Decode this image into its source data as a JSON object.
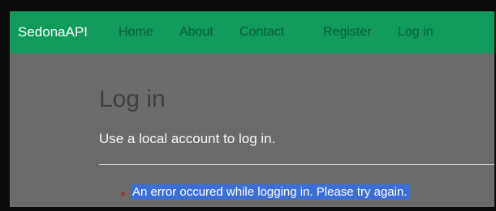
{
  "navbar": {
    "brand": "SedonaAPI",
    "links": [
      {
        "label": "Home"
      },
      {
        "label": "About"
      },
      {
        "label": "Contact"
      },
      {
        "label": "Register"
      },
      {
        "label": "Log in"
      }
    ]
  },
  "page": {
    "title": "Log in",
    "subtitle": "Use a local account to log in.",
    "error_message": "An error occured while logging in. Please try again."
  },
  "colors": {
    "navbar_bg": "#119a5c",
    "content_bg": "#6b6b6b",
    "selection_highlight": "#3b6fd6"
  }
}
